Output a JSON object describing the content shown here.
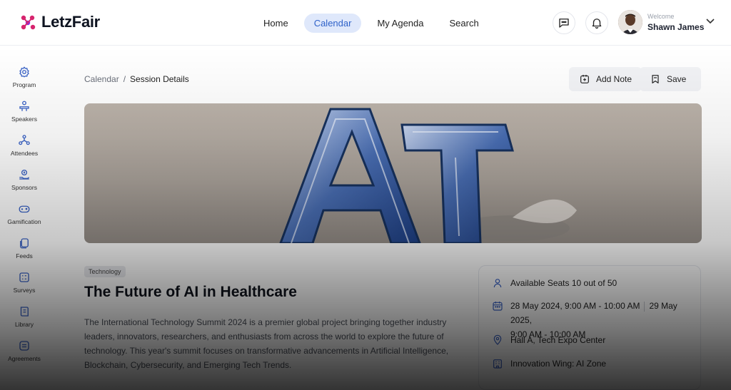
{
  "app": {
    "logo_text": "LetzFair"
  },
  "nav": {
    "items": [
      "Home",
      "Calendar",
      "My Agenda",
      "Search"
    ],
    "active": "Calendar"
  },
  "user": {
    "welcome": "Welcome",
    "name": "Shawn James"
  },
  "sidebar": {
    "items": [
      {
        "label": "Program",
        "icon": "gear-icon"
      },
      {
        "label": "Speakers",
        "icon": "speaker-icon"
      },
      {
        "label": "Attendees",
        "icon": "attendees-icon"
      },
      {
        "label": "Sponsors",
        "icon": "sponsor-icon"
      },
      {
        "label": "Gamification",
        "icon": "gamepad-icon"
      },
      {
        "label": "Feeds",
        "icon": "feeds-icon"
      },
      {
        "label": "Surveys",
        "icon": "survey-icon"
      },
      {
        "label": "Library",
        "icon": "library-icon"
      },
      {
        "label": "Agreements",
        "icon": "agreement-icon"
      }
    ]
  },
  "breadcrumb": {
    "parent": "Calendar",
    "separator": "/",
    "current": "Session Details"
  },
  "actions": {
    "add_note": "Add Note",
    "save": "Save"
  },
  "banner": {
    "text": "AI"
  },
  "session": {
    "tag": "Technology",
    "title": "The Future of AI in Healthcare",
    "description": "The International Technology Summit 2024 is a premier global project bringing together industry leaders, innovators, researchers, and enthusiasts from across the world to explore the future of technology. This year's summit focuses on transformative advancements in Artificial Intelligence, Blockchain, Cybersecurity, and Emerging Tech Trends."
  },
  "info": {
    "seats": "Available Seats 10 out of 50",
    "date_start": "28 May 2024, 9:00 AM - 10:00 AM",
    "date_end_1": "29 May 2025,",
    "date_end_2": "9:00 AM - 10:00 AM",
    "location": "Hall A, Tech Expo Center",
    "zone": "Innovation Wing: AI Zone"
  },
  "colors": {
    "accent": "#2f62c9",
    "accent_bg": "#dfe8fb",
    "brand_magenta": "#d6246e"
  }
}
